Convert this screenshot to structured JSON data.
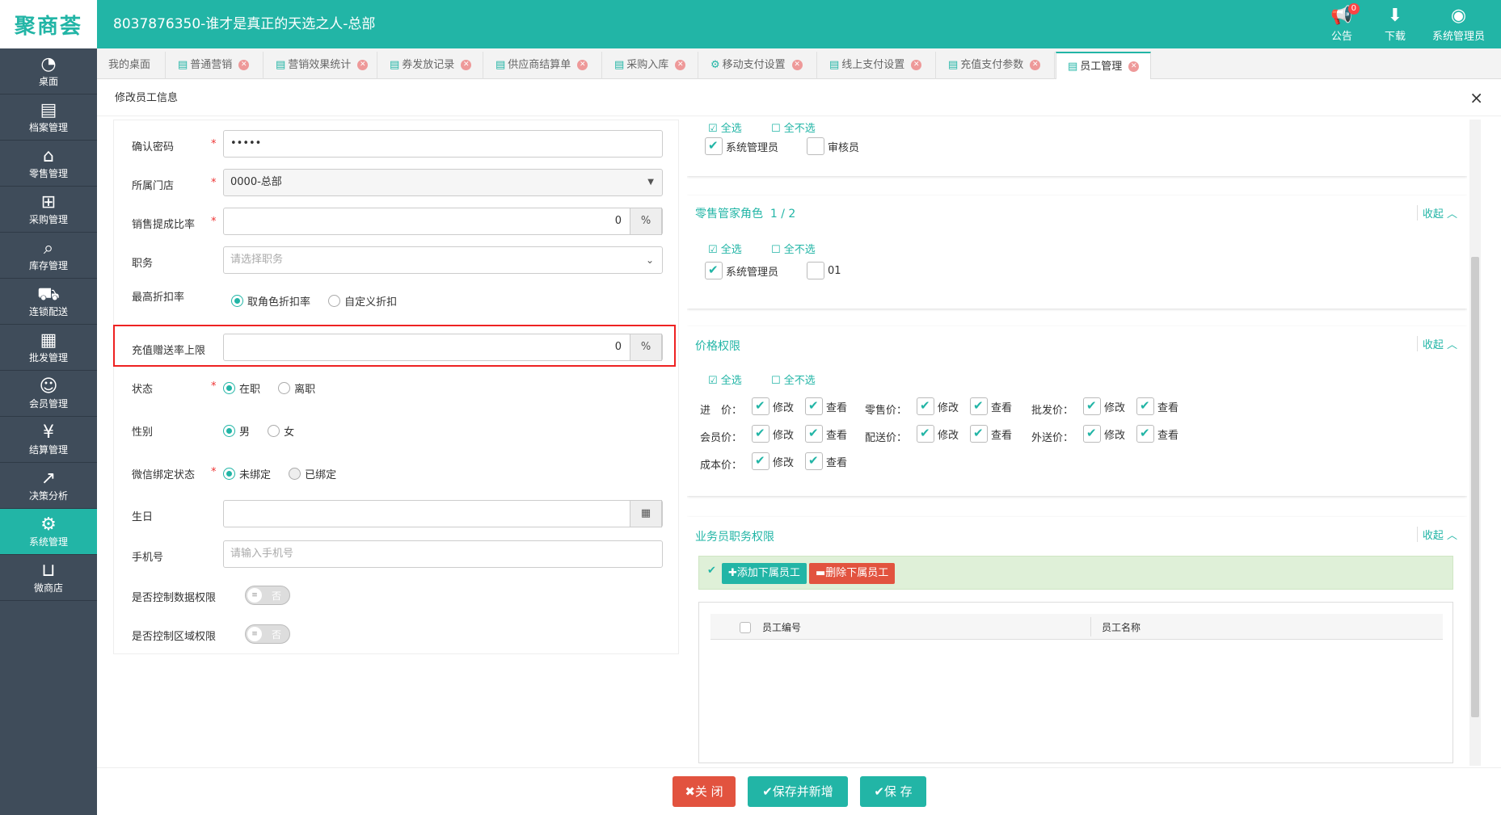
{
  "header": {
    "logo": "聚商荟",
    "title": "8037876350-谁才是真正的天选之人-总部",
    "notice_label": "公告",
    "notice_count": "0",
    "download_label": "下载",
    "user_label": "系统管理员"
  },
  "sidebar": {
    "items": [
      {
        "label": "桌面",
        "icon": "dashboard-icon"
      },
      {
        "label": "档案管理",
        "icon": "archive-icon"
      },
      {
        "label": "零售管理",
        "icon": "store-icon"
      },
      {
        "label": "采购管理",
        "icon": "cart-icon"
      },
      {
        "label": "库存管理",
        "icon": "inventory-icon"
      },
      {
        "label": "连锁配送",
        "icon": "truck-icon"
      },
      {
        "label": "批发管理",
        "icon": "wholesale-icon"
      },
      {
        "label": "会员管理",
        "icon": "member-icon"
      },
      {
        "label": "结算管理",
        "icon": "settlement-icon"
      },
      {
        "label": "决策分析",
        "icon": "chart-icon"
      },
      {
        "label": "系统管理",
        "icon": "gear-icon"
      },
      {
        "label": "微商店",
        "icon": "shop-icon"
      }
    ]
  },
  "tabs": [
    "我的桌面",
    "普通营销",
    "营销效果统计",
    "券发放记录",
    "供应商结算单",
    "采购入库",
    "移动支付设置",
    "线上支付设置",
    "充值支付参数",
    "员工管理"
  ],
  "dialog": {
    "title": "修改员工信息",
    "close": "×"
  },
  "form": {
    "confirm_password_label": "确认密码",
    "confirm_password_value": "•••••",
    "store_label": "所属门店",
    "store_value": "0000-总部",
    "commission_label": "销售提成比率",
    "commission_value": "0",
    "percent": "%",
    "position_label": "职务",
    "position_placeholder": "请选择职务",
    "discount_label": "最高折扣率",
    "discount_opt1": "取角色折扣率",
    "discount_opt2": "自定义折扣",
    "recharge_label": "充值赠送率上限",
    "recharge_value": "0",
    "status_label": "状态",
    "status_opt1": "在职",
    "status_opt2": "离职",
    "gender_label": "性别",
    "gender_opt1": "男",
    "gender_opt2": "女",
    "wechat_label": "微信绑定状态",
    "wechat_opt1": "未绑定",
    "wechat_opt2": "已绑定",
    "birthday_label": "生日",
    "phone_label": "手机号",
    "phone_placeholder": "请输入手机号",
    "data_perm_label": "是否控制数据权限",
    "area_perm_label": "是否控制区域权限",
    "toggle_off": "否"
  },
  "roles_top": {
    "select_all": "全选",
    "select_none": "全不选",
    "role1": "系统管理员",
    "role2": "审核员"
  },
  "retail_roles": {
    "title": "零售管家角色",
    "count": "1 / 2",
    "collapse": "收起",
    "select_all": "全选",
    "select_none": "全不选",
    "role1": "系统管理员",
    "role2": "01"
  },
  "price_perm": {
    "title": "价格权限",
    "collapse": "收起",
    "select_all": "全选",
    "select_none": "全不选",
    "modify": "修改",
    "view": "查看",
    "labels": [
      "进　价：",
      "零售价：",
      "批发价：",
      "会员价：",
      "配送价：",
      "外送价：",
      "成本价："
    ]
  },
  "sales_perm": {
    "title": "业务员职务权限",
    "collapse": "收起",
    "add_btn": "添加下属员工",
    "del_btn": "删除下属员工",
    "col_code": "员工编号",
    "col_name": "员工名称"
  },
  "footer": {
    "close": "关 闭",
    "save_new": "保存并新增",
    "save": "保 存"
  },
  "colors": {
    "brand": "#22b5a6",
    "sidebar": "#3f4c5a",
    "danger": "#e2533f",
    "highlight": "#e22222"
  }
}
